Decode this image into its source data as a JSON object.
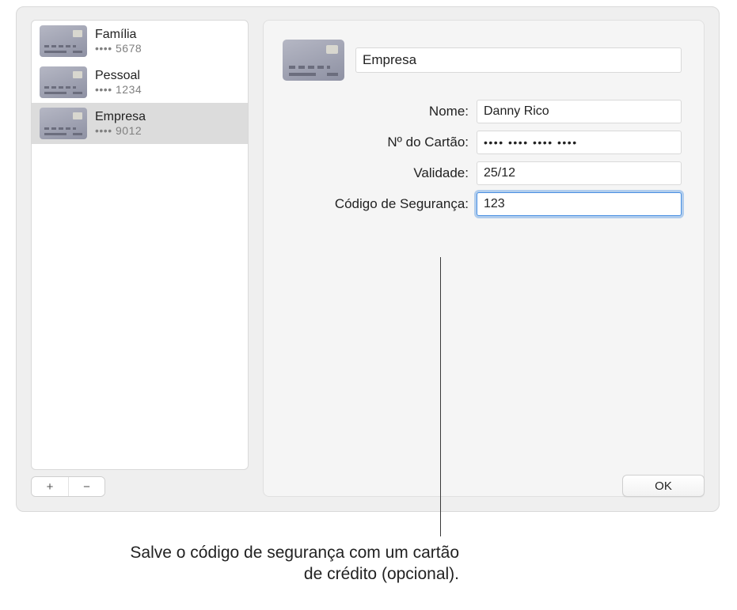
{
  "sidebar": {
    "cards": [
      {
        "name": "Família",
        "masked": "•••• 5678"
      },
      {
        "name": "Pessoal",
        "masked": "•••• 1234"
      },
      {
        "name": "Empresa",
        "masked": "•••• 9012"
      }
    ],
    "selected_index": 2,
    "add_label": "+",
    "remove_label": "−"
  },
  "detail": {
    "title": "Empresa",
    "labels": {
      "name": "Nome:",
      "card_number": "Nº do Cartão:",
      "expiry": "Validade:",
      "security": "Código de Segurança:"
    },
    "values": {
      "name": "Danny Rico",
      "card_number": "•••• •••• •••• ••••",
      "expiry": "25/12",
      "security": "123"
    }
  },
  "ok_label": "OK",
  "callout": "Salve o código de segurança com um cartão de crédito (opcional)."
}
